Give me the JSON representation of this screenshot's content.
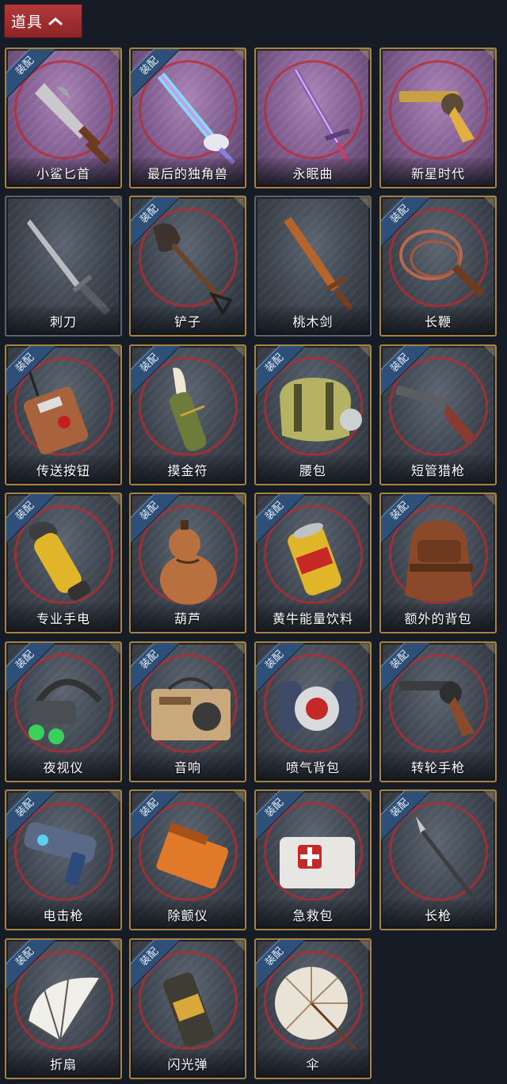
{
  "header": {
    "label": "道具",
    "icon": "chevron-up-icon"
  },
  "badge_text": "装配",
  "colors": {
    "header_bg": "#a52d30",
    "card_border": "#a8833f",
    "badge_bg": "#2d4f78",
    "rare_bg": "#8a66a0",
    "ring": "#be282d"
  },
  "items": [
    {
      "name": "小鲨匕首",
      "equipped": true,
      "rarity": "purple",
      "icon": "shark-dagger-icon"
    },
    {
      "name": "最后的独角兽",
      "equipped": true,
      "rarity": "purple",
      "icon": "unicorn-sword-icon"
    },
    {
      "name": "永眠曲",
      "equipped": false,
      "rarity": "purple",
      "icon": "eternal-sword-icon"
    },
    {
      "name": "新星时代",
      "equipped": false,
      "rarity": "purple",
      "icon": "revolver-gold-icon"
    },
    {
      "name": "刺刀",
      "equipped": false,
      "rarity": "plain",
      "icon": "bayonet-icon"
    },
    {
      "name": "铲子",
      "equipped": true,
      "rarity": "normal",
      "icon": "shovel-icon"
    },
    {
      "name": "桃木剑",
      "equipped": false,
      "rarity": "plain",
      "icon": "wooden-sword-icon"
    },
    {
      "name": "长鞭",
      "equipped": true,
      "rarity": "normal",
      "icon": "whip-icon"
    },
    {
      "name": "传送按钮",
      "equipped": true,
      "rarity": "normal",
      "icon": "teleport-button-icon"
    },
    {
      "name": "摸金符",
      "equipped": true,
      "rarity": "normal",
      "icon": "talisman-icon"
    },
    {
      "name": "腰包",
      "equipped": true,
      "rarity": "normal",
      "icon": "waist-bag-icon"
    },
    {
      "name": "短管猎枪",
      "equipped": true,
      "rarity": "normal",
      "icon": "shotgun-icon"
    },
    {
      "name": "专业手电",
      "equipped": true,
      "rarity": "normal",
      "icon": "flashlight-icon"
    },
    {
      "name": "葫芦",
      "equipped": true,
      "rarity": "normal",
      "icon": "gourd-icon"
    },
    {
      "name": "黄牛能量饮料",
      "equipped": true,
      "rarity": "normal",
      "icon": "energy-drink-icon"
    },
    {
      "name": "额外的背包",
      "equipped": true,
      "rarity": "normal",
      "icon": "backpack-icon"
    },
    {
      "name": "夜视仪",
      "equipped": true,
      "rarity": "normal",
      "icon": "night-vision-icon"
    },
    {
      "name": "音响",
      "equipped": true,
      "rarity": "normal",
      "icon": "radio-icon"
    },
    {
      "name": "喷气背包",
      "equipped": true,
      "rarity": "normal",
      "icon": "jetpack-icon"
    },
    {
      "name": "转轮手枪",
      "equipped": true,
      "rarity": "normal",
      "icon": "revolver-icon"
    },
    {
      "name": "电击枪",
      "equipped": true,
      "rarity": "normal",
      "icon": "shock-gun-icon"
    },
    {
      "name": "除颤仪",
      "equipped": true,
      "rarity": "normal",
      "icon": "defibrillator-icon"
    },
    {
      "name": "急救包",
      "equipped": true,
      "rarity": "normal",
      "icon": "first-aid-kit-icon"
    },
    {
      "name": "长枪",
      "equipped": true,
      "rarity": "normal",
      "icon": "spear-icon"
    },
    {
      "name": "折扇",
      "equipped": true,
      "rarity": "normal",
      "icon": "folding-fan-icon"
    },
    {
      "name": "闪光弹",
      "equipped": true,
      "rarity": "normal",
      "icon": "flashbang-icon"
    },
    {
      "name": "伞",
      "equipped": true,
      "rarity": "normal",
      "icon": "umbrella-icon"
    }
  ]
}
